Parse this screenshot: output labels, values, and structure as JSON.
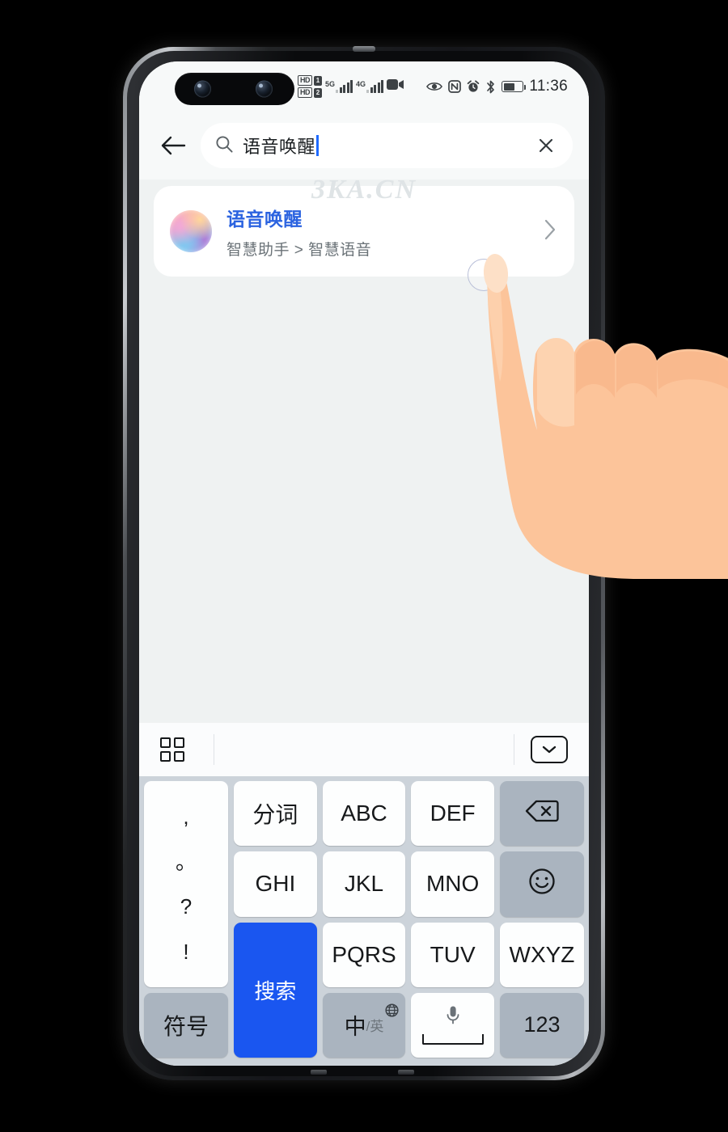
{
  "statusbar": {
    "hd1_label": "HD",
    "hd2_label": "HD",
    "sim1": "1",
    "sim2": "2",
    "net1": "5G",
    "net2": "4G",
    "video_icon": "video-camera-icon",
    "eye_icon": "eye-comfort-icon",
    "nfc_icon": "nfc-icon",
    "alarm_icon": "alarm-icon",
    "bluetooth_icon": "bluetooth-icon",
    "battery_icon": "battery-icon",
    "battery_percent": 60,
    "time": "11:36"
  },
  "search": {
    "back_icon": "back-arrow-icon",
    "search_icon": "search-icon",
    "value": "语音唤醒",
    "clear_icon": "close-icon"
  },
  "watermark": "3KA.CN",
  "results": [
    {
      "icon": "assistant-orb-icon",
      "title": "语音唤醒",
      "path": "智慧助手 > 智慧语音",
      "chevron": "chevron-right-icon"
    }
  ],
  "keyboard": {
    "toolbar": {
      "grid_icon": "grid-panel-icon",
      "collapse_icon": "chevron-down-icon"
    },
    "punctuation_key": [
      ",",
      "。",
      "?",
      "!"
    ],
    "rows": [
      [
        {
          "label": "分词",
          "style": "white",
          "name": "key-fenci"
        },
        {
          "label": "ABC",
          "style": "white",
          "name": "key-abc"
        },
        {
          "label": "DEF",
          "style": "white",
          "name": "key-def"
        },
        {
          "label": "backspace-icon",
          "style": "gray",
          "name": "key-backspace"
        }
      ],
      [
        {
          "label": "GHI",
          "style": "white",
          "name": "key-ghi"
        },
        {
          "label": "JKL",
          "style": "white",
          "name": "key-jkl"
        },
        {
          "label": "MNO",
          "style": "white",
          "name": "key-mno"
        },
        {
          "label": "emoji-icon",
          "style": "gray",
          "name": "key-emoji"
        }
      ],
      [
        {
          "label": "PQRS",
          "style": "white",
          "name": "key-pqrs"
        },
        {
          "label": "TUV",
          "style": "white",
          "name": "key-tuv"
        },
        {
          "label": "WXYZ",
          "style": "white",
          "name": "key-wxyz"
        },
        {
          "label": "搜索",
          "style": "blue",
          "name": "key-search-enter"
        }
      ],
      [
        {
          "label": "符号",
          "style": "gray",
          "name": "key-symbols"
        },
        {
          "label": "中",
          "sub": "/英",
          "style": "gray",
          "name": "key-lang-toggle"
        },
        {
          "label": "mic-space-icon",
          "style": "white",
          "name": "key-space"
        },
        {
          "label": "123",
          "style": "gray",
          "name": "key-numbers"
        }
      ]
    ],
    "enter_label": "搜索",
    "symbols_label": "符号",
    "lang_main": "中",
    "lang_sub": "/英",
    "numbers_label": "123",
    "fenci_label": "分词",
    "abc_label": "ABC",
    "def_label": "DEF",
    "ghi_label": "GHI",
    "jkl_label": "JKL",
    "mno_label": "MNO",
    "pqrs_label": "PQRS",
    "tuv_label": "TUV",
    "wxyz_label": "WXYZ"
  },
  "colors": {
    "accent_blue": "#1a56f0",
    "title_blue": "#2b63e0",
    "screen_bg": "#eff2f2",
    "keyboard_bg": "#ccd3da",
    "key_gray": "#aab4bf"
  }
}
